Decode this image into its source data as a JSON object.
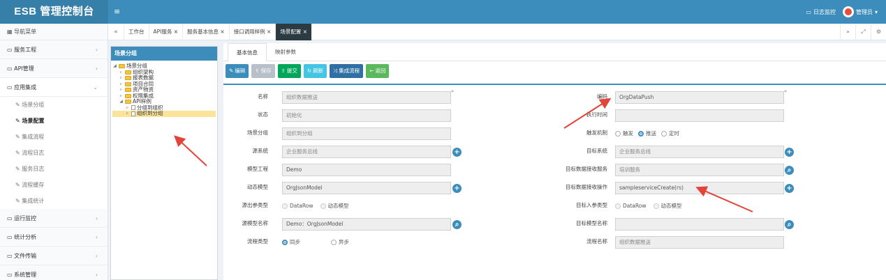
{
  "app": {
    "title": "ESB 管理控制台",
    "menu_toggle": "≡"
  },
  "topbar": {
    "log_monitor": "日志监控",
    "user": "管理员"
  },
  "sidebar": {
    "header": "导航菜单",
    "items": [
      {
        "label": "服务工程"
      },
      {
        "label": "API管理"
      },
      {
        "label": "应用集成"
      },
      {
        "label": "运行监控"
      },
      {
        "label": "统计分析"
      },
      {
        "label": "文件传输"
      },
      {
        "label": "系统管理"
      }
    ],
    "sub": [
      "场景分组",
      "场景配置",
      "集成流程",
      "流程日志",
      "服务日志",
      "流程缓存",
      "集成统计"
    ]
  },
  "tabs": [
    "工作台",
    "API服务 ×",
    "服务基本信息 ×",
    "接口调用样例 ×",
    "场景配置 ×"
  ],
  "tree": {
    "title": "场景分组",
    "nodes": [
      "场景分组",
      "组织架构",
      "报表数据",
      "项目合同",
      "资产物资",
      "权限集成",
      "API样例",
      "分组到组织",
      "组织到分组"
    ]
  },
  "form": {
    "tabs": [
      "基本信息",
      "映射参数"
    ],
    "buttons": [
      "编辑",
      "保存",
      "提交",
      "刷新",
      "集成流程",
      "返回"
    ],
    "labels": {
      "name": "名称",
      "status": "状态",
      "group": "场景分组",
      "source": "源系统",
      "model_project": "模型工程",
      "dyn_model": "动态模型",
      "out_param_type": "源出参类型",
      "src_model_name": "源模型名称",
      "flow_type": "流程类型",
      "code": "编码",
      "exec_time": "执行时间",
      "trigger": "触发机制",
      "target": "目标系统",
      "target_service": "目标数据接收服务",
      "target_op": "目标数据接收操作",
      "in_param_type": "目标入参类型",
      "target_model": "目标模型名称",
      "flow_name": "流程名称"
    },
    "values": {
      "name": "组织数据推送",
      "status": "初始化",
      "group": "组织到分组",
      "source": "企业服务总线",
      "model_project": "Demo",
      "dyn_model": "OrgJsonModel",
      "src_model_name": "Demo：OrgJsonModel",
      "code": "OrgDataPush",
      "exec_time": "",
      "target": "企业服务总线",
      "target_service": "培训服务",
      "target_op": "sampleserviceCreate(rs)",
      "target_model": "",
      "flow_name": "组织数据推送"
    },
    "radios": {
      "out": [
        "DataRow",
        "动态模型"
      ],
      "flow": [
        "同步",
        "异步"
      ],
      "trigger": [
        "触发",
        "推送",
        "定时"
      ],
      "in": [
        "DataRow",
        "动态模型"
      ]
    },
    "asterisk": "*"
  },
  "colors": {
    "primary": "#3c8dbc",
    "arrow": "#e2443a"
  }
}
